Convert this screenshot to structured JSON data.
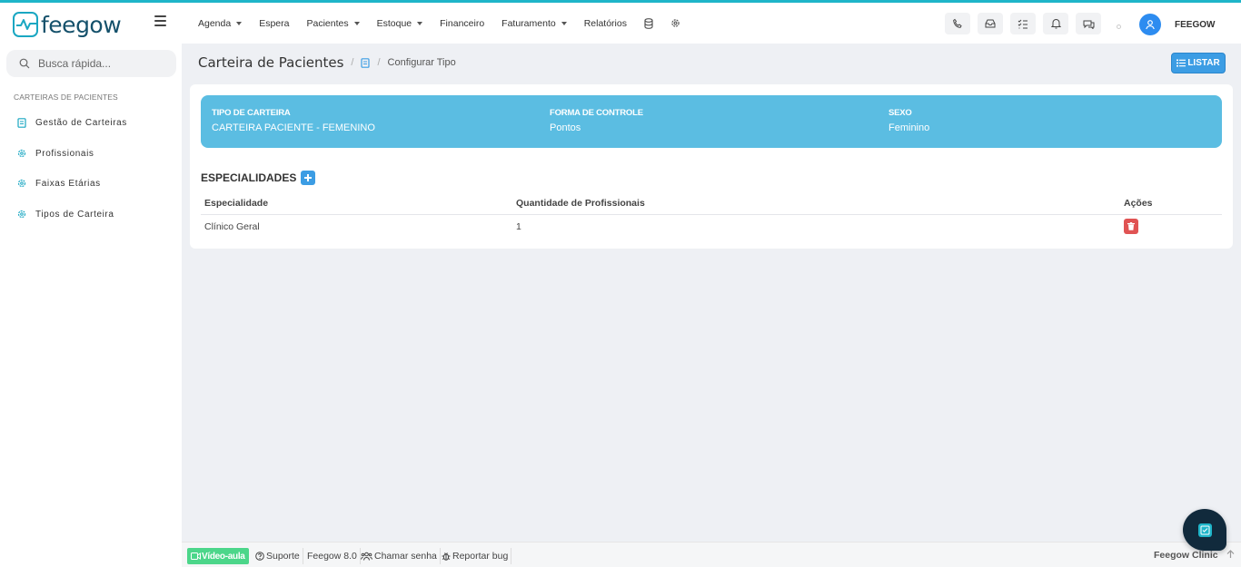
{
  "brand": {
    "logo_text": "feegow",
    "accent": "#1fb5c9"
  },
  "nav": {
    "items": [
      {
        "label": "Agenda",
        "dropdown": true
      },
      {
        "label": "Espera",
        "dropdown": false
      },
      {
        "label": "Pacientes",
        "dropdown": true
      },
      {
        "label": "Estoque",
        "dropdown": true
      },
      {
        "label": "Financeiro",
        "dropdown": false
      },
      {
        "label": "Faturamento",
        "dropdown": true
      },
      {
        "label": "Relatórios",
        "dropdown": false
      }
    ],
    "icons": [
      "database-icon",
      "gear-icon"
    ]
  },
  "toolbar": {
    "buttons": [
      "phone-icon",
      "inbox-icon",
      "tasks-icon",
      "bell-icon",
      "chat-icon"
    ],
    "user_name": "FEEGOW"
  },
  "sidebar": {
    "search_placeholder": "Busca rápida...",
    "heading": "CARTEIRAS DE PACIENTES",
    "items": [
      {
        "label": "Gestão de Carteiras",
        "icon": "book-icon"
      },
      {
        "label": "Profissionais",
        "icon": "gear-icon"
      },
      {
        "label": "Faixas Etárias",
        "icon": "gear-icon"
      },
      {
        "label": "Tipos de Carteira",
        "icon": "gear-icon"
      }
    ]
  },
  "breadcrumb": {
    "title": "Carteira de Pacientes",
    "separator": "/",
    "current": "Configurar Tipo",
    "listar_label": "LISTAR"
  },
  "info": {
    "tipo_label": "TIPO DE CARTEIRA",
    "tipo_value": "CARTEIRA PACIENTE - FEMENINO",
    "forma_label": "FORMA DE CONTROLE",
    "forma_value": "Pontos",
    "sexo_label": "SEXO",
    "sexo_value": "Feminino",
    "color": "#5bbde2"
  },
  "especialidades": {
    "title": "ESPECIALIDADES",
    "columns": [
      "Especialidade",
      "Quantidade de Profissionais",
      "Ações"
    ],
    "rows": [
      {
        "especialidade": "Clínico Geral",
        "quantidade": "1"
      }
    ]
  },
  "footer": {
    "video_label": "Vídeo-aula",
    "suporte_label": "Suporte",
    "version_label": "Feegow 8.0",
    "chamar_label": "Chamar senha",
    "bug_label": "Reportar bug",
    "brand_label": "Feegow Clinic"
  }
}
